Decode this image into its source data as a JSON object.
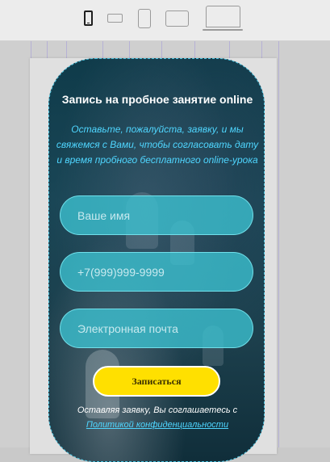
{
  "toolbar": {
    "devices": [
      {
        "name": "mobile-portrait",
        "active": true
      },
      {
        "name": "mobile-landscape",
        "active": false
      },
      {
        "name": "tablet-portrait",
        "active": false
      },
      {
        "name": "tablet-landscape",
        "active": false
      },
      {
        "name": "desktop",
        "active": false
      }
    ]
  },
  "form": {
    "title": "Запись на пробное занятие online",
    "subtitle": "Оставьте, пожалуйста, заявку, и мы свяжемся с Вами, чтобы согласовать дату и время пробного бесплатного online-урока",
    "name_placeholder": "Ваше имя",
    "phone_placeholder": "+7(999)999-9999",
    "email_placeholder": "Электронная почта",
    "submit_label": "Записаться",
    "consent_text": "Оставляя заявку, Вы соглашаетесь с",
    "policy_link": "Политикой конфиденциальности"
  },
  "colors": {
    "accent": "#4fd6ff",
    "button": "#ffe000",
    "field": "#3cc3d2",
    "card_bg": "#1a4656"
  }
}
